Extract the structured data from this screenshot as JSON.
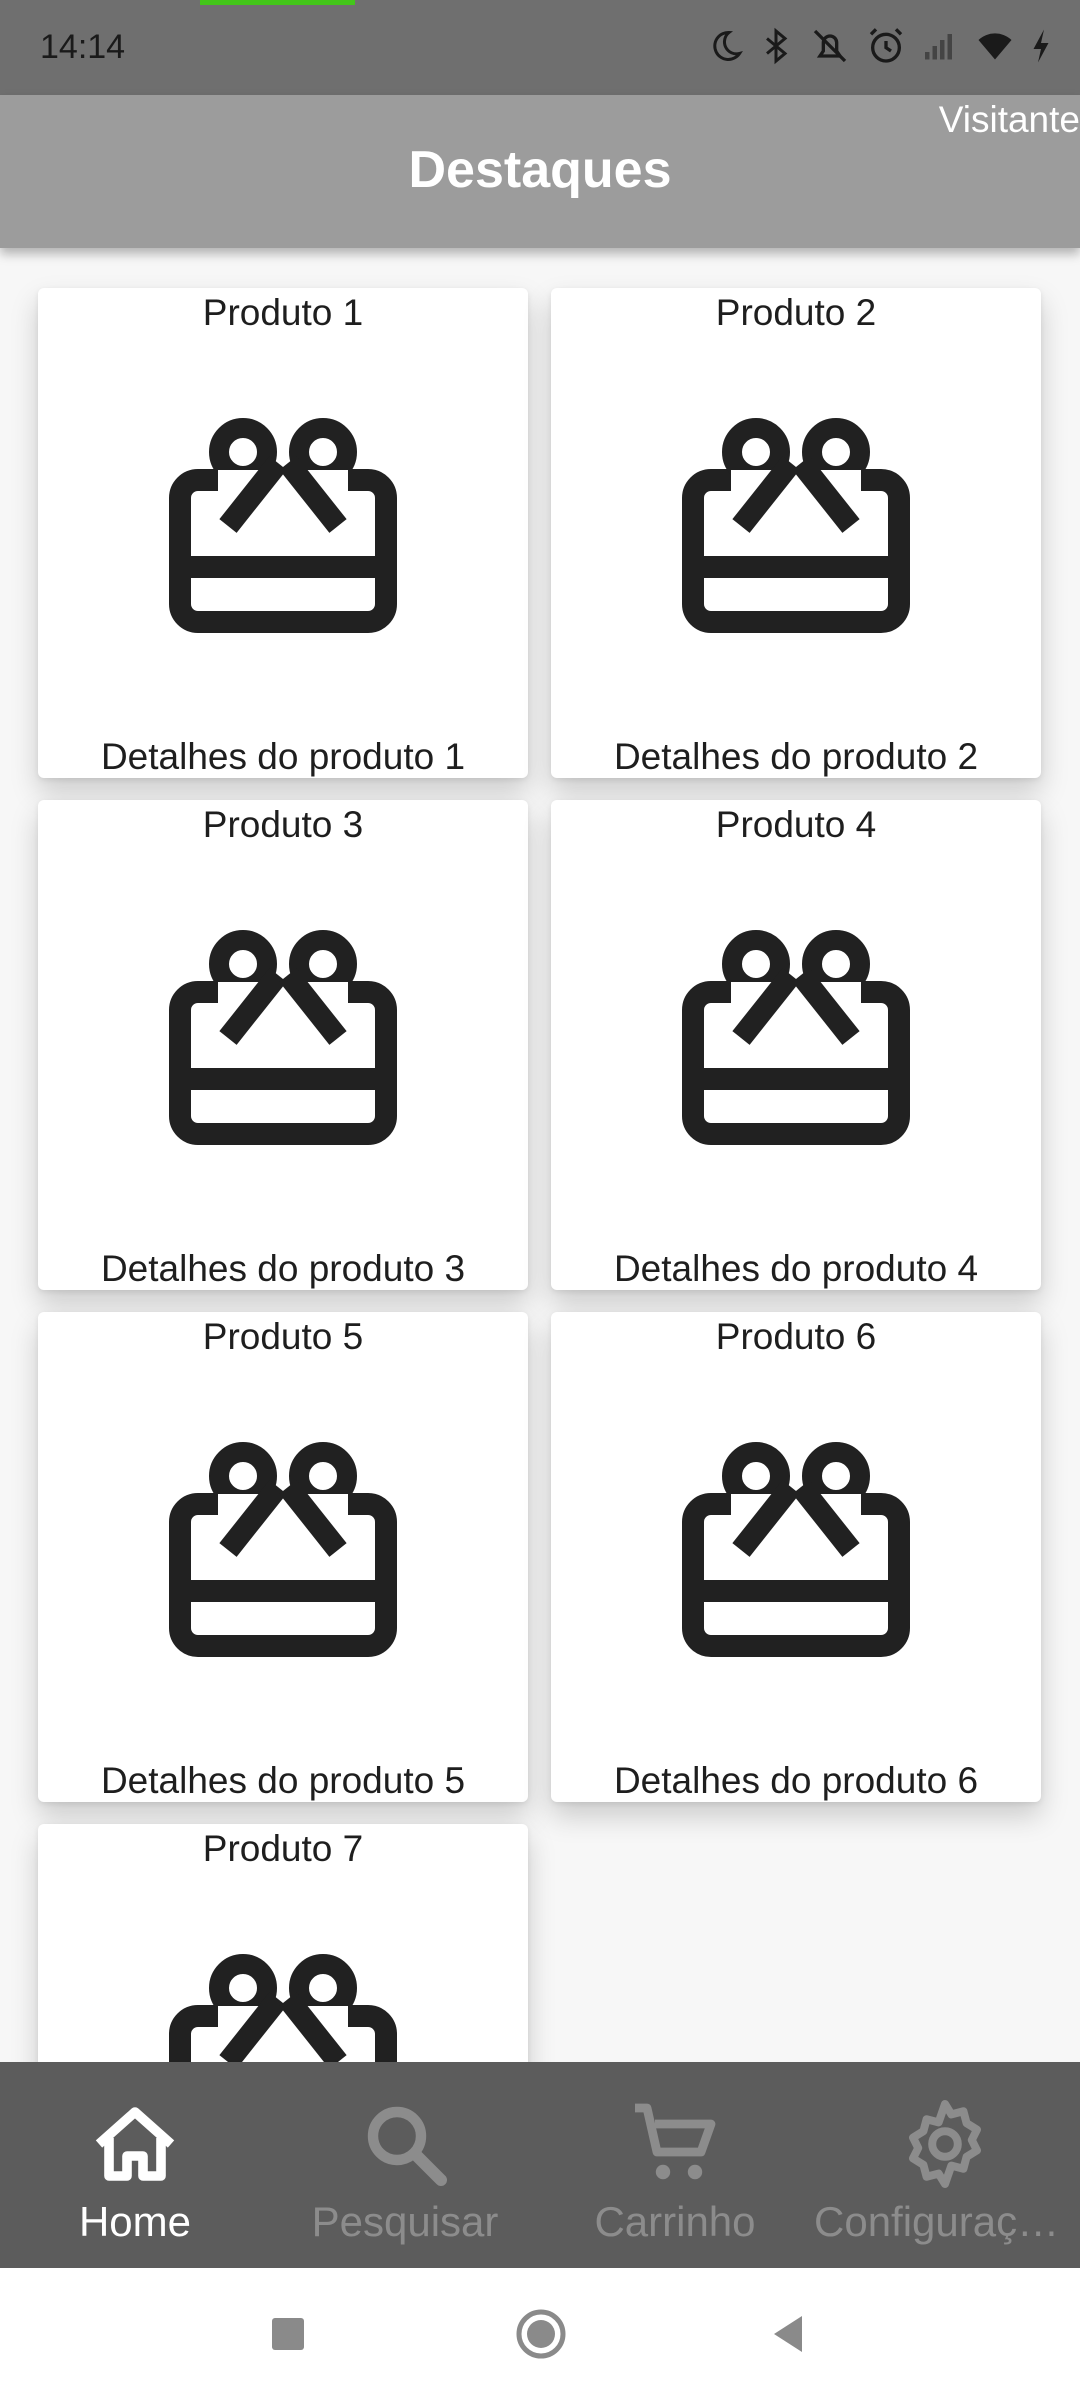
{
  "status_bar": {
    "time": "14:14",
    "icons": [
      "moon-icon",
      "bluetooth-icon",
      "mute-icon",
      "alarm-icon",
      "signal-icon",
      "wifi-icon",
      "charging-icon"
    ]
  },
  "app_bar": {
    "title": "Destaques",
    "user": "Visitante",
    "color": "#9c9c9c"
  },
  "products": [
    {
      "title": "Produto 1",
      "detail": "Detalhes do produto 1",
      "icon": "gift-card-icon"
    },
    {
      "title": "Produto 2",
      "detail": "Detalhes do produto 2",
      "icon": "gift-card-icon"
    },
    {
      "title": "Produto 3",
      "detail": "Detalhes do produto 3",
      "icon": "gift-card-icon"
    },
    {
      "title": "Produto 4",
      "detail": "Detalhes do produto 4",
      "icon": "gift-card-icon"
    },
    {
      "title": "Produto 5",
      "detail": "Detalhes do produto 5",
      "icon": "gift-card-icon"
    },
    {
      "title": "Produto 6",
      "detail": "Detalhes do produto 6",
      "icon": "gift-card-icon"
    },
    {
      "title": "Produto 7",
      "detail": "",
      "icon": "gift-card-icon"
    }
  ],
  "bottom_nav": {
    "items": [
      {
        "label": "Home",
        "icon": "home-icon",
        "active": true
      },
      {
        "label": "Pesquisar",
        "icon": "search-icon",
        "active": false
      },
      {
        "label": "Carrinho",
        "icon": "cart-icon",
        "active": false
      },
      {
        "label": "Configurações",
        "icon": "gear-icon",
        "active": false
      }
    ],
    "color": "#5c5c5c"
  },
  "system_nav": {
    "buttons": [
      "recents-button",
      "home-button",
      "back-button"
    ]
  }
}
